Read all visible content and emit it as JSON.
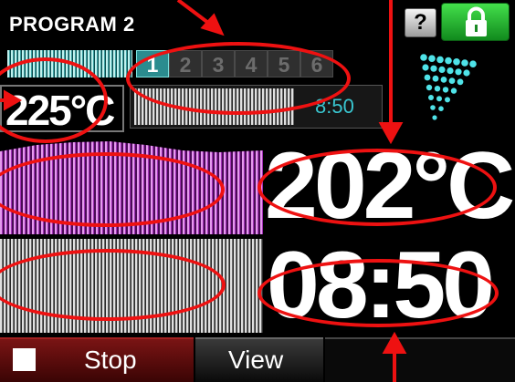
{
  "header": {
    "title": "PROGRAM 2",
    "help_label": "?",
    "lock_icon": "padlock-icon"
  },
  "steps": {
    "items": [
      "1",
      "2",
      "3",
      "4",
      "5",
      "6"
    ],
    "active_step": 1
  },
  "program_row": {
    "setpoint": "225°C",
    "program_time": "8:50"
  },
  "temperature": {
    "current": "202°C"
  },
  "timer": {
    "remaining": "08:50"
  },
  "footer": {
    "stop_label": "Stop",
    "view_label": "View"
  },
  "colors": {
    "active_step": "#2b8c8f",
    "temp_chart": "#a030b6",
    "lock_button": "#2ecc40",
    "stop_button": "#7a1414",
    "program_time": "#39c6d0",
    "annotation": "#ee1111"
  }
}
